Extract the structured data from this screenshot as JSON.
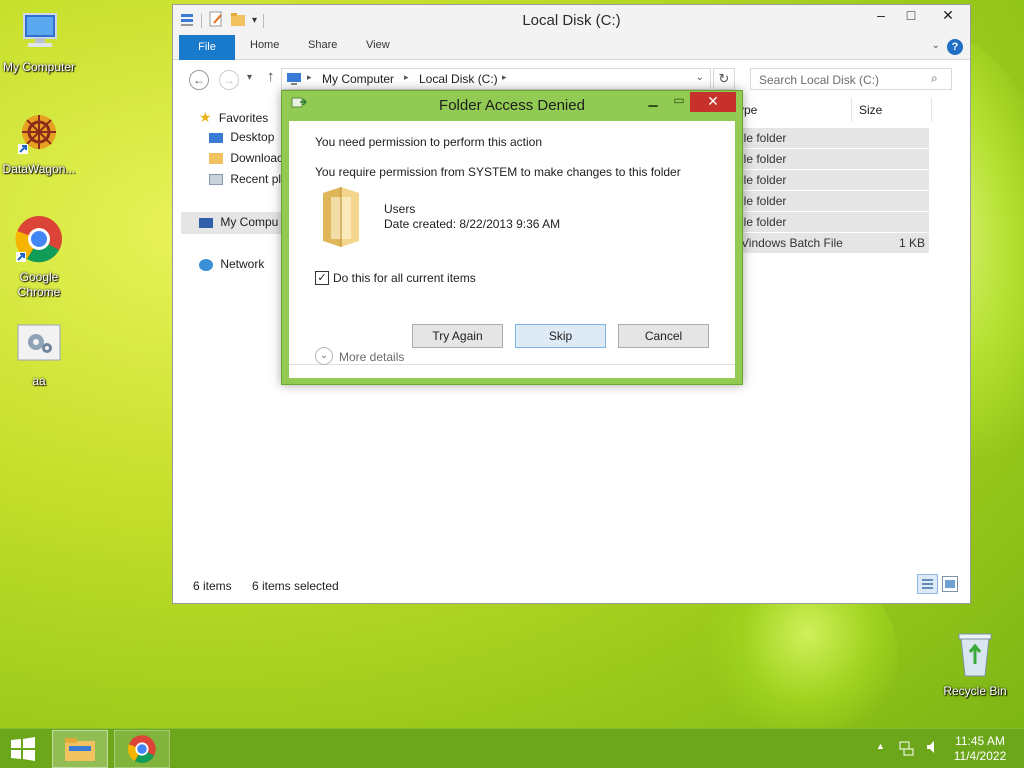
{
  "desktop": {
    "icons": [
      {
        "label": "My Computer"
      },
      {
        "label": "DataWagon..."
      },
      {
        "label": "Google Chrome"
      },
      {
        "label": "aa"
      },
      {
        "label": "Recycle Bin"
      }
    ]
  },
  "explorer": {
    "title": "Local Disk (C:)",
    "ribbon": {
      "file": "File",
      "home": "Home",
      "share": "Share",
      "view": "View"
    },
    "breadcrumb": [
      "My Computer",
      "Local Disk (C:)"
    ],
    "search_placeholder": "Search Local Disk (C:)",
    "columns": {
      "type": "ype",
      "size": "Size"
    },
    "nav": {
      "favorites": "Favorites",
      "desktop": "Desktop",
      "downloads": "Downloac",
      "recent": "Recent pla",
      "my_computer": "My Compu",
      "network": "Network"
    },
    "rows": [
      {
        "type": "ile folder",
        "size": ""
      },
      {
        "type": "ile folder",
        "size": ""
      },
      {
        "type": "ile folder",
        "size": ""
      },
      {
        "type": "ile folder",
        "size": ""
      },
      {
        "type": "ile folder",
        "size": ""
      },
      {
        "type": "Vindows Batch File",
        "size": "1 KB"
      }
    ],
    "status": {
      "items": "6 items",
      "selected": "6 items selected"
    }
  },
  "dialog": {
    "title": "Folder Access Denied",
    "line1": "You need permission to perform this action",
    "line2": "You require permission from SYSTEM to make changes to this folder",
    "item_name": "Users",
    "item_date": "Date created: 8/22/2013 9:36 AM",
    "checkbox_label": "Do this for all current items",
    "checkbox_checked": true,
    "buttons": {
      "try_again": "Try Again",
      "skip": "Skip",
      "cancel": "Cancel"
    },
    "more_details": "More details",
    "accent_color": "#92cb54"
  },
  "taskbar": {
    "time": "11:45 AM",
    "date": "11/4/2022"
  }
}
